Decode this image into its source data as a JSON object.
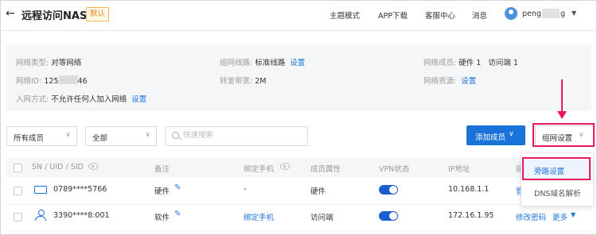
{
  "header": {
    "back_icon": "arrow-left-icon",
    "title": "远程访问NAS",
    "badge": "默认",
    "nav": [
      "主题模式",
      "APP下载",
      "客服中心",
      "消息"
    ],
    "user_name_prefix": "peng",
    "user_name_suffix": "g"
  },
  "info": {
    "network_type_key": "网络类型:",
    "network_type_val": "对等网络",
    "network_id_key": "网络ID:",
    "network_id_prefix": "125",
    "network_id_suffix": "46",
    "join_key": "入网方式:",
    "join_val": "不允许任何人加入网络",
    "group_link_key": "组网线路:",
    "group_link_val": "标准线路",
    "forward_key": "转发带宽:",
    "forward_val": "2M",
    "members_key": "网络成员:",
    "members_hw": "硬件 1",
    "members_visitor": "访问端 1",
    "resource_key": "网络资源:",
    "setting_link": "设置"
  },
  "toolbar": {
    "member_filter": "所有成员",
    "status_filter": "全部",
    "search_placeholder": "快速搜索",
    "add_member": "添加成员",
    "group_settings": "组网设置"
  },
  "table": {
    "columns": [
      "SN / UID / SID",
      "备注",
      "绑定手机",
      "成员属性",
      "VPN状态",
      "IP地址",
      "操"
    ],
    "rows": [
      {
        "icon": "hardware-device-icon",
        "sn": "0789****5766",
        "remark": "硬件",
        "phone": "-",
        "attr": "硬件",
        "vpn": true,
        "ip": "10.168.1.1",
        "action": "管"
      },
      {
        "icon": "user-icon",
        "sn": "3390****8:001",
        "remark": "软件",
        "phone": "绑定手机",
        "attr": "访问端",
        "vpn": true,
        "ip": "172.16.1.95",
        "action": "修改密码",
        "more": "更多"
      }
    ]
  },
  "dropdown": {
    "items": [
      "旁路设置",
      "DNS域名解析"
    ]
  },
  "colors": {
    "primary": "#1a73d9",
    "annotation": "#e8185a",
    "badge": "#e08b1a"
  }
}
